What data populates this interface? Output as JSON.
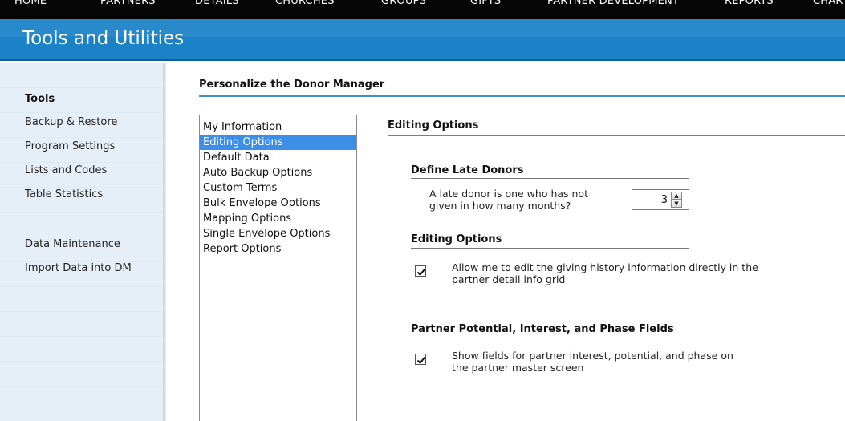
{
  "nav": {
    "items": [
      "HOME",
      "PARTNERS",
      "DETAILS",
      "CHURCHES",
      "GROUPS",
      "GIFTS",
      "PARTNER DEVELOPMENT",
      "REPORTS",
      "CHAR"
    ]
  },
  "header": {
    "title": "Tools and Utilities"
  },
  "sidebar": {
    "heading": "Tools",
    "links": [
      "Backup & Restore",
      "Program Settings",
      "Lists and Codes",
      "Table Statistics"
    ],
    "links2": [
      "Data Maintenance",
      "Import Data into DM"
    ]
  },
  "main": {
    "title": "Personalize the Donor Manager",
    "options": [
      "My Information",
      "Editing Options",
      "Default Data",
      "Auto Backup Options",
      "Custom Terms",
      "Bulk Envelope Options",
      "Mapping Options",
      "Single Envelope Options",
      "Report Options"
    ],
    "selected_option": "Editing Options",
    "panel_title": "Editing Options",
    "late_donors": {
      "title": "Define Late Donors",
      "label_line1": "A late donor is one who has not",
      "label_line2": "given in how many months?",
      "value": "3"
    },
    "editing": {
      "title": "Editing Options",
      "checked": true,
      "label_line1": "Allow me to edit the giving history information directly in the",
      "label_line2": "partner detail info grid"
    },
    "potential": {
      "title": "Partner Potential, Interest, and Phase Fields",
      "checked": true,
      "label_line1": "Show fields for partner interest, potential, and phase on",
      "label_line2": "the partner master screen"
    }
  },
  "colors": {
    "nav_bg": "#050505",
    "title_bar": "#1b82c8",
    "selection": "#3d8ee6",
    "rule": "#3f8fd0"
  }
}
